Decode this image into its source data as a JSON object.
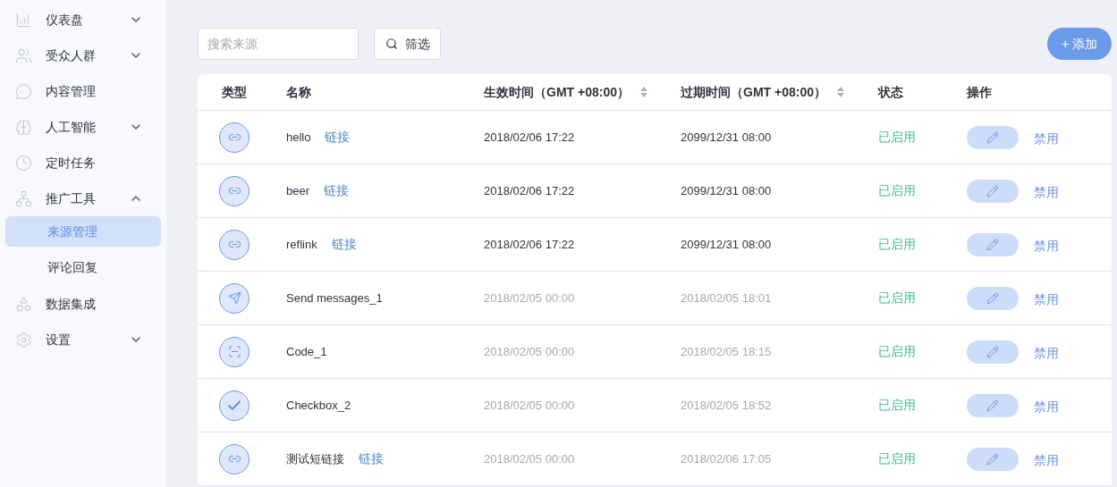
{
  "sidebar": {
    "items": [
      {
        "label": "仪表盘",
        "expanded": false
      },
      {
        "label": "受众人群",
        "expanded": false
      },
      {
        "label": "内容管理"
      },
      {
        "label": "人工智能",
        "expanded": false
      },
      {
        "label": "定时任务"
      },
      {
        "label": "推广工具",
        "expanded": true,
        "children": [
          {
            "label": "来源管理",
            "selected": true
          },
          {
            "label": "评论回复",
            "selected": false
          }
        ]
      },
      {
        "label": "数据集成"
      },
      {
        "label": "设置",
        "expanded": false
      }
    ]
  },
  "toolbar": {
    "search": {
      "placeholder": "搜索来源"
    },
    "filter_button": "筛选",
    "add_button": "+ 添加"
  },
  "table": {
    "columns": [
      {
        "label": "类型"
      },
      {
        "label": "名称"
      },
      {
        "label": "生效时间（GMT +08:00）",
        "sortable": true
      },
      {
        "label": "过期时间（GMT +08:00）",
        "sortable": true
      },
      {
        "label": "状态"
      },
      {
        "label": "操作"
      }
    ],
    "rows": [
      {
        "kind": "link",
        "name": "hello",
        "tag": "链接",
        "start": "2018/02/06 17:22",
        "end": "2099/12/31 08:00",
        "dimmed": false,
        "status": "已启用",
        "action": "禁用"
      },
      {
        "kind": "link",
        "name": "beer",
        "tag": "链接",
        "start": "2018/02/06 17:22",
        "end": "2099/12/31 08:00",
        "dimmed": false,
        "status": "已启用",
        "action": "禁用"
      },
      {
        "kind": "link",
        "name": "reflink",
        "tag": "链接",
        "start": "2018/02/06 17:22",
        "end": "2099/12/31 08:00",
        "dimmed": false,
        "status": "已启用",
        "action": "禁用"
      },
      {
        "kind": "send",
        "name": "Send messages_1",
        "start": "2018/02/05 00:00",
        "end": "2018/02/05 18:01",
        "dimmed": true,
        "status": "已启用",
        "action": "禁用"
      },
      {
        "kind": "code",
        "name": "Code_1",
        "start": "2018/02/05 00:00",
        "end": "2018/02/05 18:15",
        "dimmed": true,
        "status": "已启用",
        "action": "禁用"
      },
      {
        "kind": "checkbox",
        "name": "Checkbox_2",
        "start": "2018/02/05 00:00",
        "end": "2018/02/05 18:52",
        "dimmed": true,
        "status": "已启用",
        "action": "禁用"
      },
      {
        "kind": "link",
        "name": "测试短链接",
        "tag": "链接",
        "start": "2018/02/05 00:00",
        "end": "2018/02/06 17:05",
        "dimmed": true,
        "status": "已启用",
        "action": "禁用"
      }
    ]
  }
}
